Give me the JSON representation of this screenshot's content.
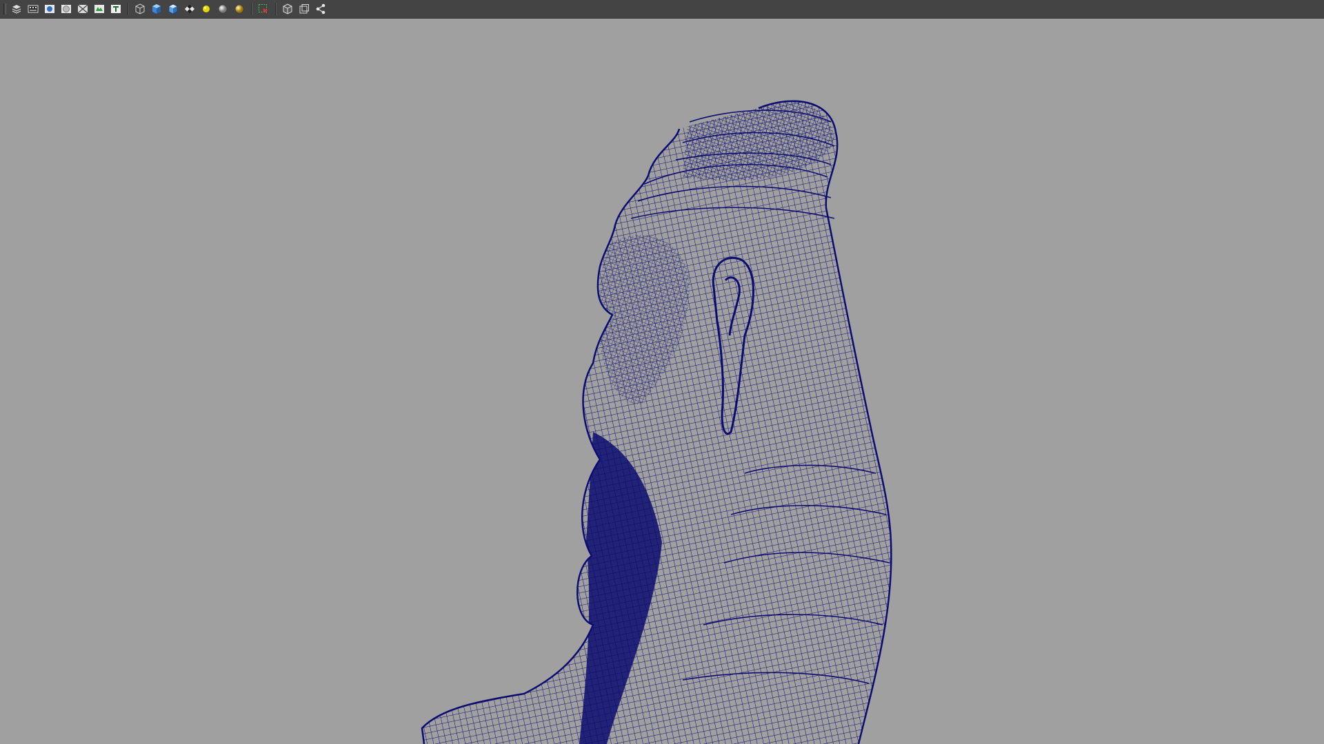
{
  "app": {
    "panel": "perspective-viewport",
    "display_mode": "wireframe",
    "background_color": "#a0a0a0",
    "wire_color": "#0c0c70",
    "toolbar_color": "#444444"
  },
  "toolbar": {
    "groups": [
      [
        "layers-icon",
        "film-gate-icon",
        "camera-attributes-icon",
        "resolution-gate-icon",
        "safe-area-icon",
        "grease-pencil-icon",
        "text-field-icon"
      ],
      [
        "wireframe-cube-icon",
        "smooth-shade-cube-icon",
        "textured-cube-icon",
        "checker-icon",
        "default-light-icon",
        "all-lights-icon",
        "shadows-icon"
      ],
      [
        "select-highlight-icon"
      ],
      [
        "isolate-select-icon",
        "frame-icon",
        "node-graph-icon"
      ]
    ]
  },
  "scene": {
    "subject": "wireframe-bust",
    "view": "side-profile"
  }
}
